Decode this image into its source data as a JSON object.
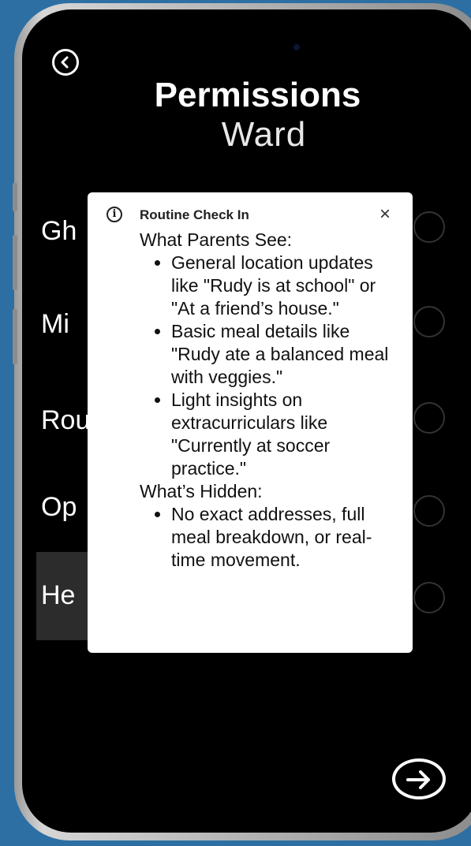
{
  "screen": {
    "title": "Permissions",
    "subtitle": "Ward"
  },
  "options": [
    {
      "label": "Gh"
    },
    {
      "label": "Mi"
    },
    {
      "label": "Rou"
    },
    {
      "label": "Op"
    },
    {
      "label": "He"
    }
  ],
  "tooltip": {
    "title": "Routine Check In",
    "close_symbol": "×",
    "info_symbol": "i",
    "sections": [
      {
        "heading": "What Parents See:",
        "items": [
          "General location updates like \"Rudy is at school\" or \"At a friend’s house.\"",
          "Basic meal details like \"Rudy ate a balanced meal with veggies.\"",
          "Light insights on extracurriculars like \"Currently at soccer practice.\""
        ]
      },
      {
        "heading": "What’s Hidden:",
        "items": [
          "No exact addresses, full meal breakdown, or real-time movement."
        ]
      }
    ]
  },
  "icons": {
    "back": "chevron-left-circle",
    "next": "arrow-right-circle",
    "info": "info-circle",
    "close": "close-x"
  },
  "colors": {
    "background": "#2d6fa3",
    "screen": "#000000",
    "tooltip": "#ffffff",
    "highlight": "#2c2c2c"
  }
}
